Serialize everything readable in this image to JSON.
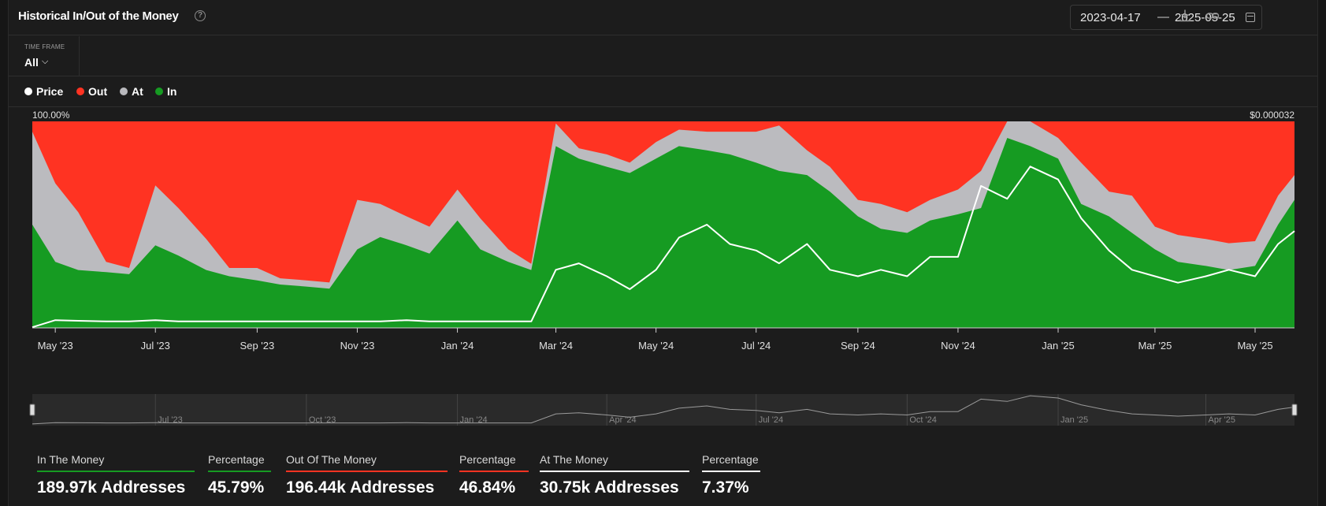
{
  "header": {
    "title": "Historical In/Out of the Money",
    "date_start": "2023-04-17",
    "date_sep": "—",
    "date_end": "2025-05-25"
  },
  "timeframe": {
    "label": "TIME FRAME",
    "value": "All"
  },
  "legend": [
    {
      "label": "Price",
      "color": "#ffffff"
    },
    {
      "label": "Out",
      "color": "#ff3322"
    },
    {
      "label": "At",
      "color": "#b9b9bd"
    },
    {
      "label": "In",
      "color": "#169b22"
    }
  ],
  "colors": {
    "in": "#169b22",
    "at": "#bbbbbf",
    "out": "#ff3322",
    "price": "#ffffff"
  },
  "stats": [
    {
      "label": "In The Money",
      "value": "189.97k Addresses",
      "underline": "#169b22"
    },
    {
      "label": "Percentage",
      "value": "45.79%",
      "underline": "#169b22"
    },
    {
      "label": "Out Of The Money",
      "value": "196.44k Addresses",
      "underline": "#ff3322"
    },
    {
      "label": "Percentage",
      "value": "46.84%",
      "underline": "#ff3322"
    },
    {
      "label": "At The Money",
      "value": "30.75k Addresses",
      "underline": "#ffffff"
    },
    {
      "label": "Percentage",
      "value": "7.37%",
      "underline": "#ffffff"
    }
  ],
  "chart_data": {
    "type": "area",
    "stacked": true,
    "y_left_label": "100.00%",
    "y_right_label": "$0.000032",
    "x_ticks": [
      "May '23",
      "Jul '23",
      "Sep '23",
      "Nov '23",
      "Jan '24",
      "Mar '24",
      "May '24",
      "Jul '24",
      "Sep '24",
      "Nov '24",
      "Jan '25",
      "Mar '25",
      "May '25"
    ],
    "navigator_ticks": [
      "Jul '23",
      "Oct '23",
      "Jan '24",
      "Apr '24",
      "Jul '24",
      "Oct '24",
      "Jan '25",
      "Apr '25"
    ],
    "x": [
      "2023-04-17",
      "2023-05-01",
      "2023-05-15",
      "2023-06-01",
      "2023-06-15",
      "2023-07-01",
      "2023-07-15",
      "2023-08-01",
      "2023-08-15",
      "2023-09-01",
      "2023-09-15",
      "2023-10-01",
      "2023-10-15",
      "2023-11-01",
      "2023-11-15",
      "2023-12-01",
      "2023-12-15",
      "2024-01-01",
      "2024-01-15",
      "2024-02-01",
      "2024-02-15",
      "2024-03-01",
      "2024-03-15",
      "2024-04-01",
      "2024-04-15",
      "2024-05-01",
      "2024-05-15",
      "2024-06-01",
      "2024-06-15",
      "2024-07-01",
      "2024-07-15",
      "2024-08-01",
      "2024-08-15",
      "2024-09-01",
      "2024-09-15",
      "2024-10-01",
      "2024-10-15",
      "2024-11-01",
      "2024-11-15",
      "2024-12-01",
      "2024-12-15",
      "2025-01-01",
      "2025-01-15",
      "2025-02-01",
      "2025-02-15",
      "2025-03-01",
      "2025-03-15",
      "2025-04-01",
      "2025-04-15",
      "2025-05-01",
      "2025-05-15",
      "2025-05-25"
    ],
    "series": [
      {
        "name": "In",
        "values": [
          50,
          32,
          28,
          27,
          26,
          40,
          35,
          28,
          25,
          23,
          21,
          20,
          19,
          38,
          44,
          40,
          36,
          52,
          38,
          32,
          28,
          88,
          82,
          78,
          75,
          82,
          88,
          86,
          84,
          80,
          76,
          74,
          66,
          54,
          48,
          46,
          52,
          55,
          58,
          92,
          88,
          82,
          60,
          54,
          46,
          38,
          32,
          30,
          28,
          30,
          50,
          62
        ]
      },
      {
        "name": "At",
        "values": [
          45,
          38,
          28,
          5,
          3,
          29,
          23,
          15,
          4,
          6,
          3,
          3,
          3,
          24,
          16,
          14,
          13,
          15,
          15,
          6,
          3,
          11,
          5,
          6,
          5,
          8,
          8,
          9,
          11,
          15,
          22,
          12,
          12,
          8,
          12,
          10,
          10,
          12,
          18,
          8,
          12,
          10,
          20,
          12,
          18,
          11,
          13,
          13,
          13,
          12,
          14,
          12
        ]
      },
      {
        "name": "Price",
        "values": [
          1e-07,
          1.2e-06,
          1.1e-06,
          1e-06,
          1e-06,
          1.2e-06,
          1e-06,
          1e-06,
          1e-06,
          1e-06,
          1e-06,
          1e-06,
          1e-06,
          1e-06,
          1e-06,
          1.2e-06,
          1e-06,
          1e-06,
          1e-06,
          1e-06,
          1e-06,
          9e-06,
          1e-05,
          8e-06,
          6e-06,
          9e-06,
          1.4e-05,
          1.6e-05,
          1.3e-05,
          1.2e-05,
          1e-05,
          1.3e-05,
          9e-06,
          8e-06,
          9e-06,
          8e-06,
          1.1e-05,
          1.1e-05,
          2.2e-05,
          2e-05,
          2.5e-05,
          2.3e-05,
          1.7e-05,
          1.2e-05,
          9e-06,
          8e-06,
          7e-06,
          8e-06,
          9e-06,
          8e-06,
          1.3e-05,
          1.5e-05
        ]
      }
    ],
    "y_left_range": [
      0,
      100
    ],
    "y_right_range": [
      0,
      3.2e-05
    ],
    "grid": false,
    "legend_position": "top-left"
  }
}
